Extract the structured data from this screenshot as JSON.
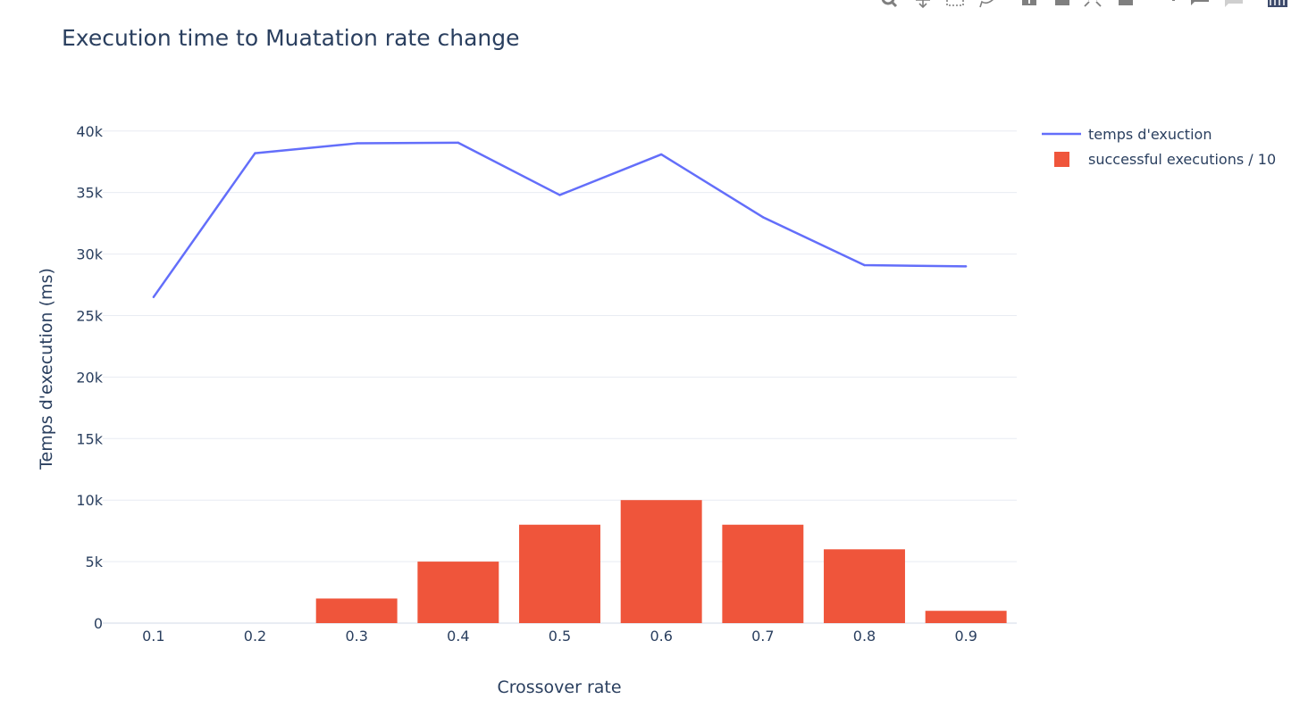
{
  "modebar": {
    "icons": [
      "zoom-icon",
      "pan-icon",
      "box-select-icon",
      "lasso-select-icon",
      "zoom-in-icon",
      "zoom-out-icon",
      "autoscale-icon",
      "reset-axes-icon",
      "spike-lines-icon",
      "hover-closest-icon",
      "hover-compare-icon",
      "plotly-logo-icon"
    ]
  },
  "colors": {
    "line": "#636efa",
    "bar": "#ef553b",
    "grid": "#e8ecf3",
    "text": "#2a3f5f",
    "icon": "#7f7f7f",
    "logo": "#3d4a6b"
  },
  "chart_data": {
    "type": "bar",
    "title": "Execution time to Muatation rate change",
    "xlabel": "Crossover rate",
    "ylabel": "Temps d'execution (ms)",
    "categories": [
      "0.1",
      "0.2",
      "0.3",
      "0.4",
      "0.5",
      "0.6",
      "0.7",
      "0.8",
      "0.9"
    ],
    "ylim": [
      0,
      41000
    ],
    "yticks": [
      0,
      5000,
      10000,
      15000,
      20000,
      25000,
      30000,
      35000,
      40000
    ],
    "ytick_labels": [
      "0",
      "5k",
      "10k",
      "15k",
      "20k",
      "25k",
      "30k",
      "35k",
      "40k"
    ],
    "grid": true,
    "legend_position": "top-right",
    "series": [
      {
        "name": "temps d'exuction",
        "type": "line",
        "color": "#636efa",
        "values": [
          26500,
          38200,
          39000,
          39050,
          34800,
          38100,
          33000,
          29100,
          29000
        ]
      },
      {
        "name": "successful executions / 10",
        "type": "bar",
        "color": "#ef553b",
        "values": [
          0,
          0,
          2000,
          5000,
          8000,
          10000,
          8000,
          6000,
          1000
        ]
      }
    ]
  }
}
